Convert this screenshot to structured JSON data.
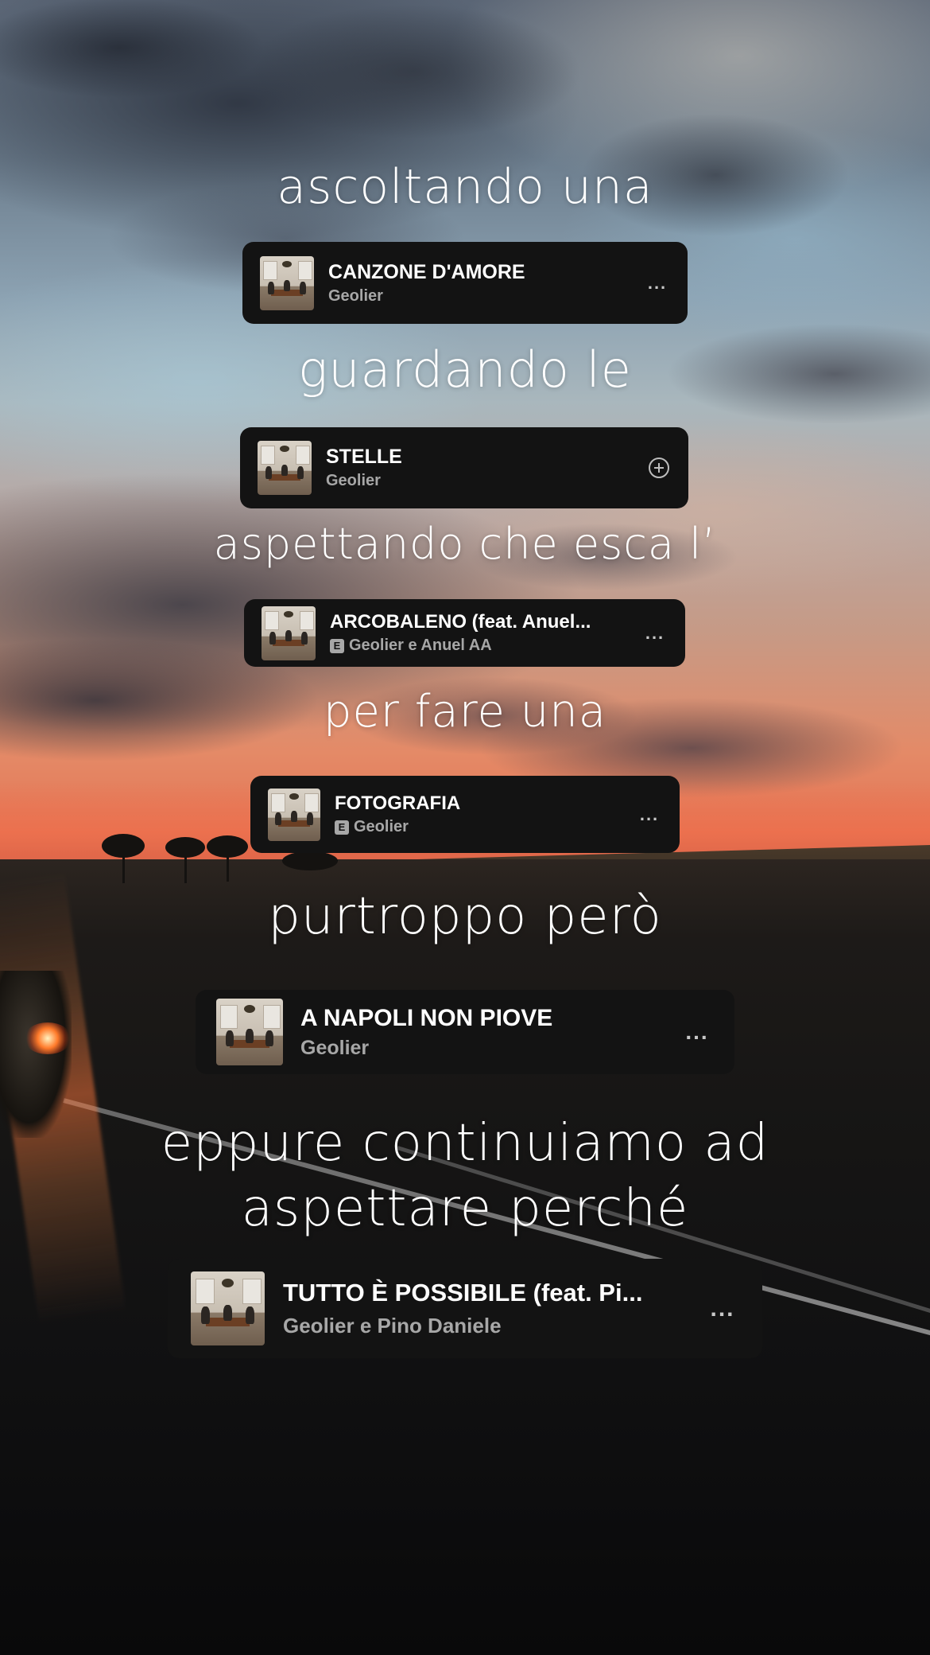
{
  "captions": [
    "ascoltando una",
    "guardando le",
    "aspettando che esca l’",
    "per fare una",
    "purtroppo però",
    "eppure continuiamo ad",
    "aspettare perché"
  ],
  "songs": [
    {
      "title": "CANZONE D'AMORE",
      "artist": "Geolier",
      "explicit": false,
      "action": "more-options-icon",
      "action_label": "..."
    },
    {
      "title": "STELLE",
      "artist": "Geolier",
      "explicit": false,
      "action": "add-icon",
      "action_label": ""
    },
    {
      "title": "ARCOBALENO (feat. Anuel...",
      "artist": "Geolier e Anuel AA",
      "explicit": true,
      "action": "more-options-icon",
      "action_label": "..."
    },
    {
      "title": "FOTOGRAFIA",
      "artist": "Geolier",
      "explicit": true,
      "action": "more-options-icon",
      "action_label": "..."
    },
    {
      "title": "A NAPOLI NON PIOVE",
      "artist": "Geolier",
      "explicit": false,
      "action": "more-options-icon",
      "action_label": "..."
    },
    {
      "title": "TUTTO È POSSIBILE (feat. Pi...",
      "artist": "Geolier e Pino Daniele",
      "explicit": false,
      "action": "more-options-icon",
      "action_label": "..."
    }
  ],
  "explicit_badge": "E",
  "colors": {
    "card_bg": "#131313",
    "artist_gray": "#a7a7a7",
    "caption": "#ffffff"
  }
}
